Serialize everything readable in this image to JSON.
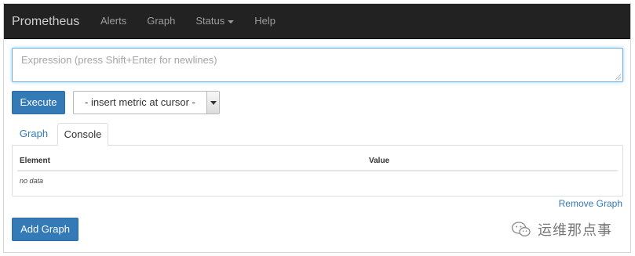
{
  "navbar": {
    "brand": "Prometheus",
    "items": [
      {
        "label": "Alerts"
      },
      {
        "label": "Graph"
      },
      {
        "label": "Status",
        "dropdown": true
      },
      {
        "label": "Help"
      }
    ]
  },
  "expression": {
    "placeholder": "Expression (press Shift+Enter for newlines)",
    "value": ""
  },
  "execute_label": "Execute",
  "metric_select": {
    "selected": "- insert metric at cursor -"
  },
  "tabs": [
    {
      "label": "Graph",
      "active": false
    },
    {
      "label": "Console",
      "active": true
    }
  ],
  "table": {
    "headers": [
      "Element",
      "Value"
    ],
    "empty_text": "no data"
  },
  "remove_graph_label": "Remove Graph",
  "add_graph_label": "Add Graph",
  "watermark": {
    "text": "运维那点事",
    "icon": "wechat-icon"
  },
  "colors": {
    "navbar_bg": "#222222",
    "primary": "#337ab7",
    "link": "#337ab7"
  }
}
